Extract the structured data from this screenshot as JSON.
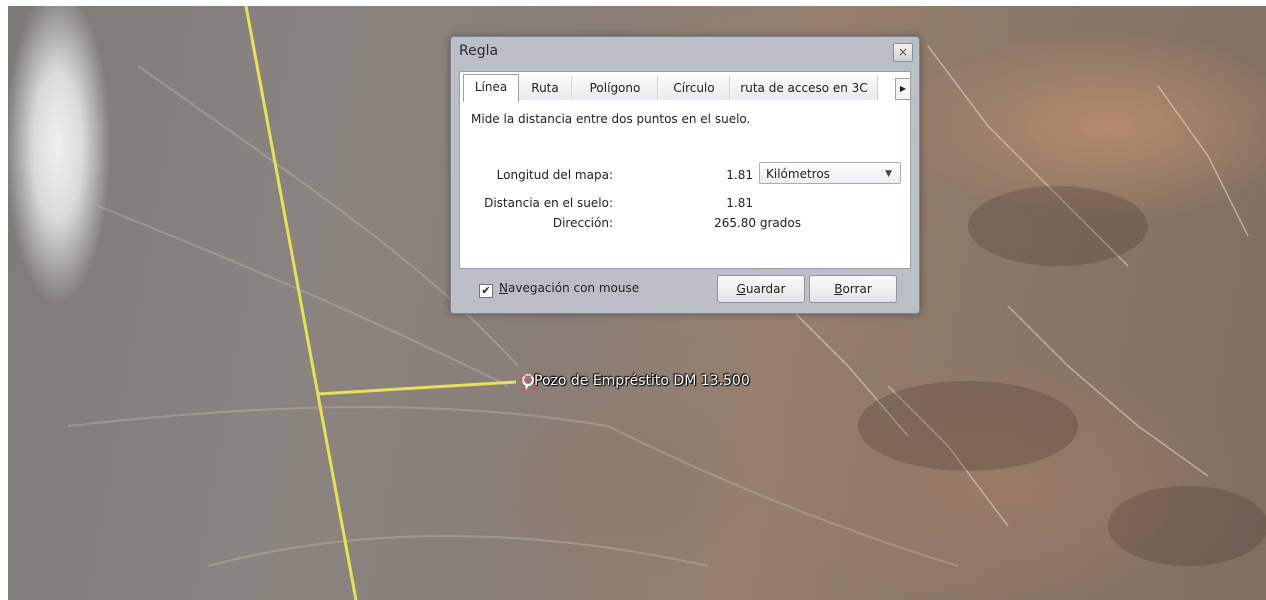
{
  "map": {
    "placemark_label": "Pozo de Empréstito DM 13.500"
  },
  "dialog": {
    "title": "Regla",
    "close_glyph": "×",
    "tabs": [
      {
        "label": "Línea",
        "active": true
      },
      {
        "label": "Ruta",
        "active": false
      },
      {
        "label": "Polígono",
        "active": false
      },
      {
        "label": "Círculo",
        "active": false
      },
      {
        "label": "ruta de acceso en 3C",
        "active": false
      }
    ],
    "tab_scroll_glyph": "▶",
    "description": "Mide la distancia entre dos puntos en el suelo.",
    "rows": {
      "map_length_label": "Longitud del mapa:",
      "map_length_value": "1.81",
      "ground_distance_label": "Distancia en el suelo:",
      "ground_distance_value": "1.81",
      "direction_label": "Dirección:",
      "direction_value": "265.80 grados"
    },
    "unit_select": {
      "selected": "Kilómetros",
      "arrow": "▼"
    },
    "mouse_nav": {
      "label_rest": "avegación con mouse",
      "label_accesskey": "N",
      "checked": true,
      "check_glyph": "✔"
    },
    "buttons": {
      "save_accesskey": "G",
      "save_rest": "uardar",
      "clear_accesskey": "B",
      "clear_rest": "orrar"
    }
  },
  "colors": {
    "measure_line": "#e6e05a",
    "dialog_bg": "#bec4ce"
  }
}
